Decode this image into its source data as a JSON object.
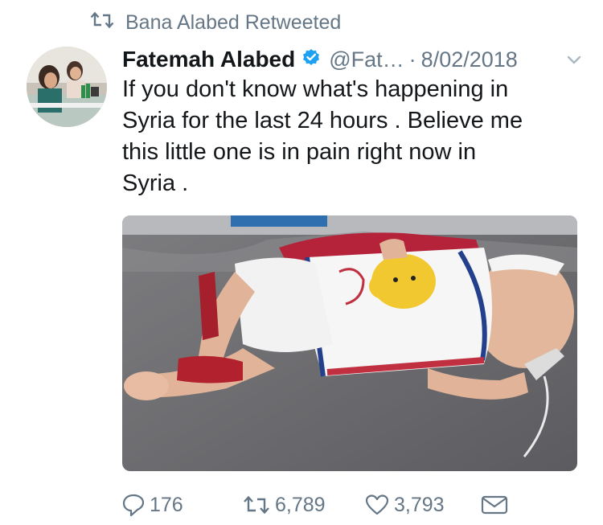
{
  "retweet_banner": {
    "label": "Bana Alabed Retweeted",
    "icon": "retweet-icon"
  },
  "tweet": {
    "display_name": "Fatemah Alabed",
    "verified": true,
    "handle": "@Fat…",
    "separator": "·",
    "date": "8/02/2018",
    "text": "If you don't know what's happening in\nSyria for the last 24 hours . Believe me\nthis little one is in pain right now in\nSyria ."
  },
  "actions": {
    "replies": {
      "count": "176",
      "icon": "reply-icon"
    },
    "retweets": {
      "count": "6,789",
      "icon": "retweet-icon"
    },
    "likes": {
      "count": "3,793",
      "icon": "heart-icon"
    },
    "dm": {
      "icon": "envelope-icon"
    }
  },
  "colors": {
    "muted": "#657786",
    "text": "#14171a",
    "verified": "#1da1f2"
  }
}
